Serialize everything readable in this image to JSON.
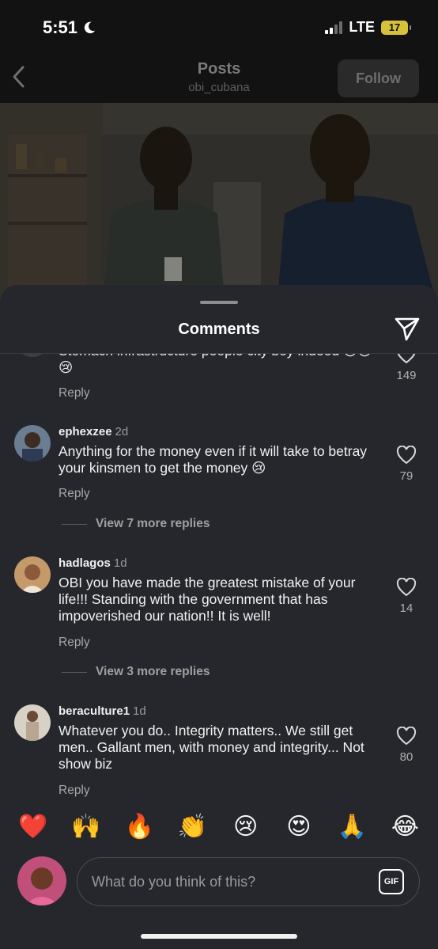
{
  "status_bar": {
    "time": "5:51",
    "network": "LTE",
    "battery": "17"
  },
  "header": {
    "title": "Posts",
    "username": "obi_cubana",
    "follow_label": "Follow"
  },
  "sheet": {
    "title": "Comments"
  },
  "comments": [
    {
      "text": "Stomach infrastructure people city boy indeed 😢😢😢",
      "reply_label": "Reply",
      "likes": "149"
    },
    {
      "username": "ephexzee",
      "time": "2d",
      "text": "Anything for the money even if it will take to betray your kinsmen to get the money 😢",
      "reply_label": "Reply",
      "likes": "79",
      "view_more": "View 7 more replies"
    },
    {
      "username": "hadlagos",
      "time": "1d",
      "text": "OBI you have made the greatest mistake of your life!!! Standing with the government that has impoverished our nation!! It is well!",
      "reply_label": "Reply",
      "likes": "14",
      "view_more": "View 3 more replies"
    },
    {
      "username": "beraculture1",
      "time": "1d",
      "text": "Whatever you do.. Integrity matters.. We still get men.. Gallant men, with money and integrity... Not show biz",
      "reply_label": "Reply",
      "likes": "80"
    }
  ],
  "emoji_bar": [
    "❤️",
    "🙌",
    "🔥",
    "👏",
    "😢",
    "😍",
    "🙏",
    "😂"
  ],
  "composer": {
    "placeholder": "What do you think of this?",
    "gif_label": "GIF"
  },
  "colors": {
    "background": "#000000",
    "sheet": "#25272c",
    "text": "#f5f5f5",
    "muted": "#a6a6a6"
  }
}
